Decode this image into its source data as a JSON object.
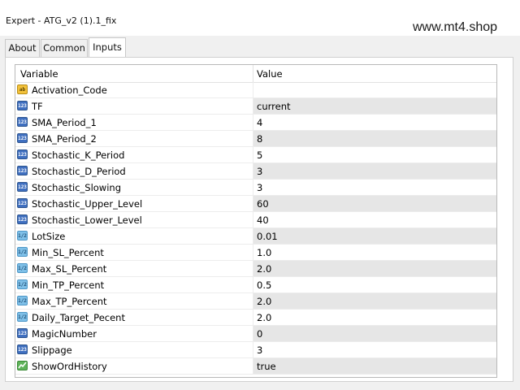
{
  "window": {
    "title": "Expert - ATG_v2 (1).1_fix",
    "watermark": "www.mt4.shop"
  },
  "tabs": [
    {
      "label": "About",
      "active": false
    },
    {
      "label": "Common",
      "active": false
    },
    {
      "label": "Inputs",
      "active": true
    }
  ],
  "table": {
    "columns": {
      "variable": "Variable",
      "value": "Value"
    },
    "rows": [
      {
        "name": "Activation_Code",
        "value": "",
        "type": "string"
      },
      {
        "name": "TF",
        "value": "current",
        "type": "int"
      },
      {
        "name": "SMA_Period_1",
        "value": "4",
        "type": "int"
      },
      {
        "name": "SMA_Period_2",
        "value": "8",
        "type": "int"
      },
      {
        "name": "Stochastic_K_Period",
        "value": "5",
        "type": "int"
      },
      {
        "name": "Stochastic_D_Period",
        "value": "3",
        "type": "int"
      },
      {
        "name": "Stochastic_Slowing",
        "value": "3",
        "type": "int"
      },
      {
        "name": "Stochastic_Upper_Level",
        "value": "60",
        "type": "int"
      },
      {
        "name": "Stochastic_Lower_Level",
        "value": "40",
        "type": "int"
      },
      {
        "name": "LotSize",
        "value": "0.01",
        "type": "double"
      },
      {
        "name": "Min_SL_Percent",
        "value": "1.0",
        "type": "double"
      },
      {
        "name": "Max_SL_Percent",
        "value": "2.0",
        "type": "double"
      },
      {
        "name": "Min_TP_Percent",
        "value": "0.5",
        "type": "double"
      },
      {
        "name": "Max_TP_Percent",
        "value": "2.0",
        "type": "double"
      },
      {
        "name": "Daily_Target_Pecent",
        "value": "2.0",
        "type": "double"
      },
      {
        "name": "MagicNumber",
        "value": "0",
        "type": "int"
      },
      {
        "name": "Slippage",
        "value": "3",
        "type": "int"
      },
      {
        "name": "ShowOrdHistory",
        "value": "true",
        "type": "bool"
      }
    ]
  },
  "icons": {
    "string": "string-type-icon",
    "int": "integer-type-icon",
    "double": "double-type-icon",
    "bool": "boolean-type-icon"
  },
  "colors": {
    "alt_row": "#e6e6e6",
    "int_icon": "#3f6fc0",
    "double_icon": "#7fc0e8",
    "string_icon": "#f3c23b",
    "bool_icon": "#5fb35a"
  }
}
